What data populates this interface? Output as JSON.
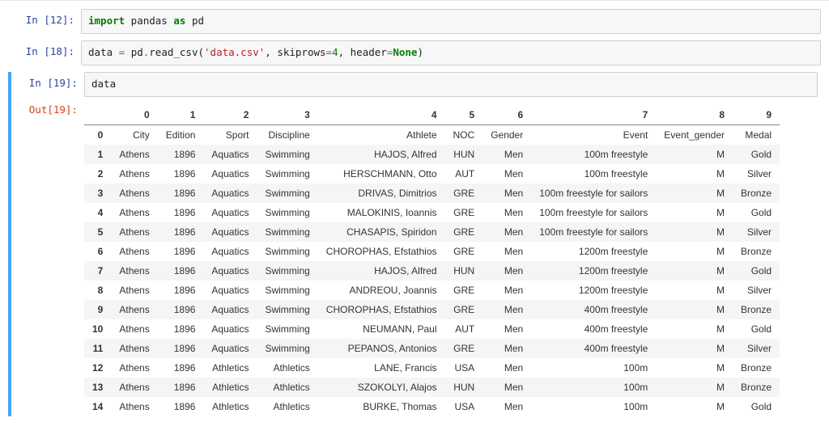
{
  "cells": [
    {
      "prompt_in": "In [12]:",
      "code_tokens": [
        {
          "t": "import",
          "cls": "kw-bold"
        },
        {
          "t": " pandas ",
          "cls": "plain"
        },
        {
          "t": "as",
          "cls": "kw-bold"
        },
        {
          "t": " pd",
          "cls": "plain"
        }
      ]
    },
    {
      "prompt_in": "In [18]:",
      "code_tokens": [
        {
          "t": "data ",
          "cls": "plain"
        },
        {
          "t": "=",
          "cls": "op"
        },
        {
          "t": " pd",
          "cls": "plain"
        },
        {
          "t": ".",
          "cls": "op"
        },
        {
          "t": "read_csv(",
          "cls": "plain"
        },
        {
          "t": "'data.csv'",
          "cls": "str"
        },
        {
          "t": ", skiprows",
          "cls": "plain"
        },
        {
          "t": "=",
          "cls": "op"
        },
        {
          "t": "4",
          "cls": "num"
        },
        {
          "t": ", header",
          "cls": "plain"
        },
        {
          "t": "=",
          "cls": "op"
        },
        {
          "t": "None",
          "cls": "kw-green"
        },
        {
          "t": ")",
          "cls": "plain"
        }
      ]
    }
  ],
  "out_cell": {
    "prompt_in": "In [19]:",
    "prompt_out": "Out[19]:",
    "code_tokens": [
      {
        "t": "data",
        "cls": "plain"
      }
    ],
    "table": {
      "columns": [
        "0",
        "1",
        "2",
        "3",
        "4",
        "5",
        "6",
        "7",
        "8",
        "9"
      ],
      "rows": [
        {
          "idx": "0",
          "cells": [
            "City",
            "Edition",
            "Sport",
            "Discipline",
            "Athlete",
            "NOC",
            "Gender",
            "Event",
            "Event_gender",
            "Medal"
          ]
        },
        {
          "idx": "1",
          "cells": [
            "Athens",
            "1896",
            "Aquatics",
            "Swimming",
            "HAJOS, Alfred",
            "HUN",
            "Men",
            "100m freestyle",
            "M",
            "Gold"
          ]
        },
        {
          "idx": "2",
          "cells": [
            "Athens",
            "1896",
            "Aquatics",
            "Swimming",
            "HERSCHMANN, Otto",
            "AUT",
            "Men",
            "100m freestyle",
            "M",
            "Silver"
          ]
        },
        {
          "idx": "3",
          "cells": [
            "Athens",
            "1896",
            "Aquatics",
            "Swimming",
            "DRIVAS, Dimitrios",
            "GRE",
            "Men",
            "100m freestyle for sailors",
            "M",
            "Bronze"
          ]
        },
        {
          "idx": "4",
          "cells": [
            "Athens",
            "1896",
            "Aquatics",
            "Swimming",
            "MALOKINIS, Ioannis",
            "GRE",
            "Men",
            "100m freestyle for sailors",
            "M",
            "Gold"
          ]
        },
        {
          "idx": "5",
          "cells": [
            "Athens",
            "1896",
            "Aquatics",
            "Swimming",
            "CHASAPIS, Spiridon",
            "GRE",
            "Men",
            "100m freestyle for sailors",
            "M",
            "Silver"
          ]
        },
        {
          "idx": "6",
          "cells": [
            "Athens",
            "1896",
            "Aquatics",
            "Swimming",
            "CHOROPHAS, Efstathios",
            "GRE",
            "Men",
            "1200m freestyle",
            "M",
            "Bronze"
          ]
        },
        {
          "idx": "7",
          "cells": [
            "Athens",
            "1896",
            "Aquatics",
            "Swimming",
            "HAJOS, Alfred",
            "HUN",
            "Men",
            "1200m freestyle",
            "M",
            "Gold"
          ]
        },
        {
          "idx": "8",
          "cells": [
            "Athens",
            "1896",
            "Aquatics",
            "Swimming",
            "ANDREOU, Joannis",
            "GRE",
            "Men",
            "1200m freestyle",
            "M",
            "Silver"
          ]
        },
        {
          "idx": "9",
          "cells": [
            "Athens",
            "1896",
            "Aquatics",
            "Swimming",
            "CHOROPHAS, Efstathios",
            "GRE",
            "Men",
            "400m freestyle",
            "M",
            "Bronze"
          ]
        },
        {
          "idx": "10",
          "cells": [
            "Athens",
            "1896",
            "Aquatics",
            "Swimming",
            "NEUMANN, Paul",
            "AUT",
            "Men",
            "400m freestyle",
            "M",
            "Gold"
          ]
        },
        {
          "idx": "11",
          "cells": [
            "Athens",
            "1896",
            "Aquatics",
            "Swimming",
            "PEPANOS, Antonios",
            "GRE",
            "Men",
            "400m freestyle",
            "M",
            "Silver"
          ]
        },
        {
          "idx": "12",
          "cells": [
            "Athens",
            "1896",
            "Athletics",
            "Athletics",
            "LANE, Francis",
            "USA",
            "Men",
            "100m",
            "M",
            "Bronze"
          ]
        },
        {
          "idx": "13",
          "cells": [
            "Athens",
            "1896",
            "Athletics",
            "Athletics",
            "SZOKOLYI, Alajos",
            "HUN",
            "Men",
            "100m",
            "M",
            "Bronze"
          ]
        },
        {
          "idx": "14",
          "cells": [
            "Athens",
            "1896",
            "Athletics",
            "Athletics",
            "BURKE, Thomas",
            "USA",
            "Men",
            "100m",
            "M",
            "Gold"
          ]
        }
      ]
    }
  }
}
